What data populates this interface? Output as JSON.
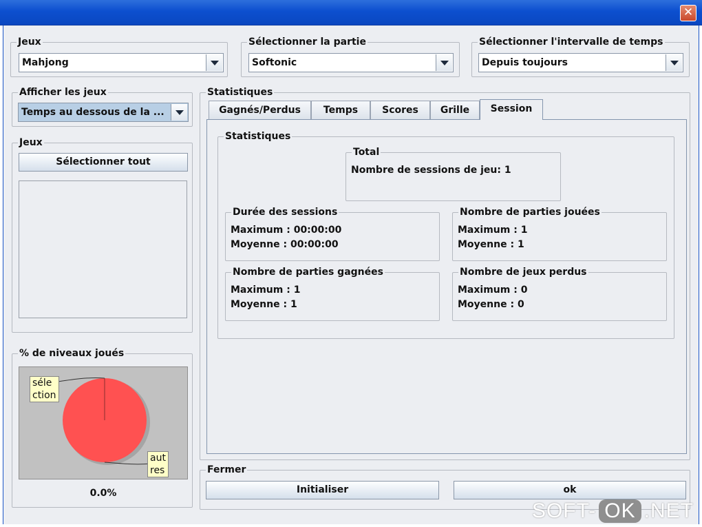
{
  "window": {
    "close_label": "✕"
  },
  "top": {
    "games": {
      "legend": "Jeux",
      "value": "Mahjong"
    },
    "game_select": {
      "legend": "Sélectionner la partie",
      "value": "Softonic"
    },
    "interval": {
      "legend": "Sélectionner l'intervalle de temps",
      "value": "Depuis toujours"
    }
  },
  "left": {
    "show_games": {
      "legend": "Afficher les jeux",
      "value": "Temps au dessous de la ..."
    },
    "games_panel": {
      "legend": "Jeux",
      "select_all": "Sélectionner tout"
    },
    "levels": {
      "legend": "% de niveaux joués",
      "note_selection": [
        "séle",
        "ction"
      ],
      "note_others": [
        "aut",
        "res"
      ],
      "percent": "0.0%"
    }
  },
  "stats": {
    "legend": "Statistiques",
    "tabs": [
      "Gagnés/Perdus",
      "Temps",
      "Scores",
      "Grille",
      "Session"
    ],
    "active_tab": "Session",
    "inner_legend": "Statistiques",
    "total": {
      "legend": "Total",
      "line": "Nombre de sessions de jeu: 1"
    },
    "duration": {
      "legend": "Durée des sessions",
      "max": "Maximum : 00:00:00",
      "avg": "Moyenne : 00:00:00"
    },
    "played": {
      "legend": "Nombre de parties jouées",
      "max": "Maximum : 1",
      "avg": "Moyenne : 1"
    },
    "won": {
      "legend": "Nombre de parties gagnées",
      "max": "Maximum : 1",
      "avg": "Moyenne : 1"
    },
    "lost": {
      "legend": "Nombre de jeux perdus",
      "max": "Maximum : 0",
      "avg": "Moyenne : 0"
    }
  },
  "footer": {
    "legend": "Fermer",
    "reset": "Initialiser",
    "ok": "ok"
  },
  "watermark": {
    "left": "SOFT-",
    "mid": "OK",
    "right": ".NET"
  },
  "colors": {
    "titlebar": "#0c4fcf",
    "pie": "#ff5151",
    "chart_bg": "#c1c1c1",
    "note_bg": "#ffffc8"
  }
}
